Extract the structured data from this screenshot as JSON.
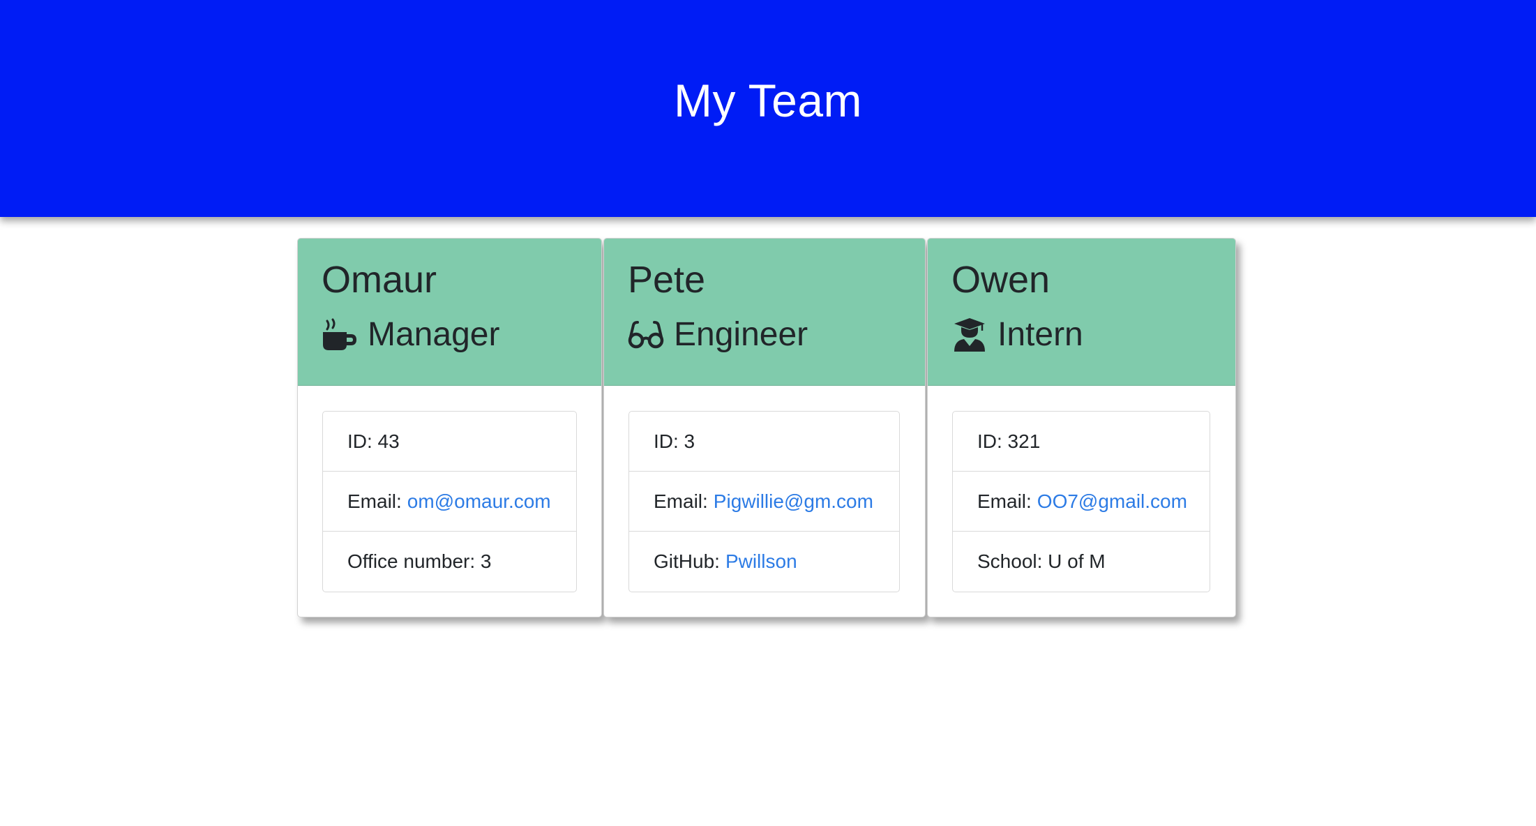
{
  "header": {
    "title": "My Team"
  },
  "cards": [
    {
      "name": "Omaur",
      "role": "Manager",
      "role_icon": "coffee-mug-icon",
      "id_text": "ID: 43",
      "email_label": "Email:",
      "email": "om@omaur.com",
      "extra_text": "Office number: 3"
    },
    {
      "name": "Pete",
      "role": "Engineer",
      "role_icon": "glasses-icon",
      "id_text": "ID: 3",
      "email_label": "Email:",
      "email": "Pigwillie@gm.com",
      "github_label": "GitHub:",
      "github": "Pwillson"
    },
    {
      "name": "Owen",
      "role": "Intern",
      "role_icon": "graduate-icon",
      "id_text": "ID: 321",
      "email_label": "Email:",
      "email": "OO7@gmail.com",
      "extra_text": "School: U of M"
    }
  ],
  "colors": {
    "header_bg": "#001cf5",
    "card_header_bg": "#80cbac",
    "link": "#2c7be5"
  }
}
